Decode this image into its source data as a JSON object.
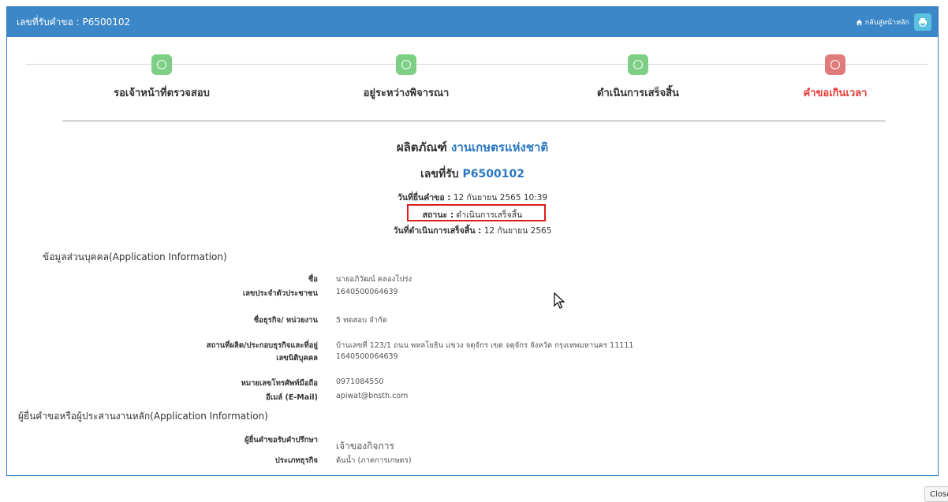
{
  "header": {
    "title": "เลขที่รับคำขอ : P6500102",
    "home_label": "กลับสู่หน้าหลัก"
  },
  "steps": [
    {
      "label": "รอเจ้าหน้าที่ตรวจสอบ",
      "color": "#7ccf84"
    },
    {
      "label": "อยู่ระหว่างพิจารณา",
      "color": "#7ccf84"
    },
    {
      "label": "ดำเนินการเสร็จสิ้น",
      "color": "#7ccf84"
    },
    {
      "label": "คำขอเกินเวลา",
      "color": "#e07b7b"
    }
  ],
  "product": {
    "prefix": "ผลิตภัณฑ์",
    "name": "งานเกษตรแห่งชาติ"
  },
  "receipt": {
    "prefix": "เลขที่รับ",
    "number": "P6500102"
  },
  "submit": {
    "label": "วันที่ยื่นคำขอ :",
    "value": "12 กันยายน 2565 10:39"
  },
  "status": {
    "label": "สถานะ :",
    "value": "ดำเนินการเสร็จสิ้น"
  },
  "completed": {
    "label": "วันที่ดำเนินการเสร็จสิ้น :",
    "value": "12 กันยายน 2565"
  },
  "section1": "ข้อมูลส่วนบุคคล(Application Information)",
  "section2": "ผู้ยื่นคำขอหรือผู้ประสานงานหลัก(Application Information)",
  "fields": {
    "name": {
      "label": "ชื่อ",
      "value": "นายอภิวัฒน์ คลองโปร่ง"
    },
    "id_card": {
      "label": "เลขประจำตัวประชาชน",
      "value": "1640500064639"
    },
    "business": {
      "label": "ชื่อธุรกิจ/ หน่วยงาน",
      "value": "5 ทดสอบ จำกัด"
    },
    "address": {
      "label": "สถานที่ผลิต/ประกอบธุรกิจและที่อยู่",
      "value": "บ้านเลขที่ 123/1 ถนน พหลโยธิน แขวง จตุจักร เขต จตุจักร จังหวัด กรุงเทพมหานคร 11111"
    },
    "juristic": {
      "label": "เลขนิติบุคคล",
      "value": "1640500064639"
    },
    "phone": {
      "label": "หมายเลขโทรศัพท์มือถือ",
      "value": "0971084550"
    },
    "email": {
      "label": "อีเมล์ (E-Mail)",
      "value": "apiwat@bnsth.com"
    },
    "applicant": {
      "label": "ผู้ยื่นคำขอรับคำปรึกษา",
      "value": "เจ้าของกิจการ"
    },
    "biz_type": {
      "label": "ประเภทธุรกิจ",
      "value": "ต้นน้ำ (ภาคการเกษตร)"
    }
  },
  "close_label": "Close"
}
